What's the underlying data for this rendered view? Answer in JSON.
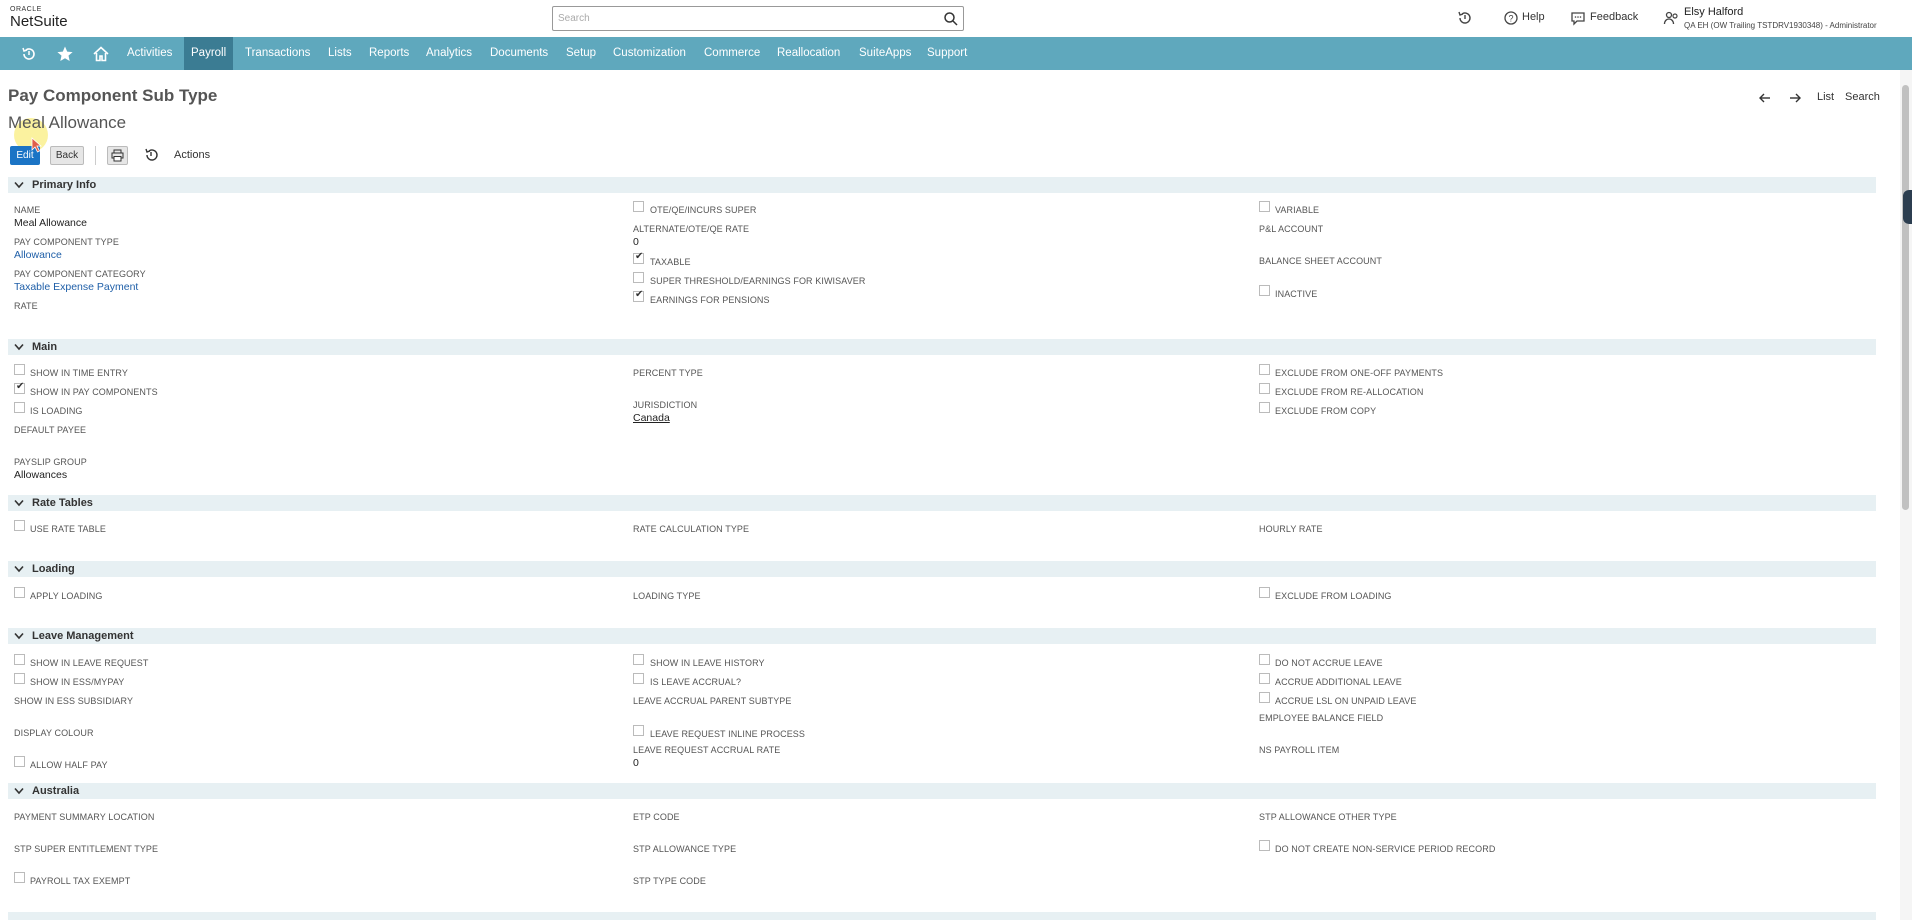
{
  "header": {
    "logo_top": "ORACLE",
    "logo_main": "NetSuite",
    "search_placeholder": "Search",
    "help_label": "Help",
    "feedback_label": "Feedback",
    "user_name": "Elsy Halford",
    "user_role": "QA EH (OW Trailing TSTDRV1930348) - Administrator"
  },
  "nav": {
    "items": [
      "Activities",
      "Payroll",
      "Transactions",
      "Lists",
      "Reports",
      "Analytics",
      "Documents",
      "Setup",
      "Customization",
      "Commerce",
      "Reallocation",
      "SuiteApps",
      "Support"
    ],
    "active": "Payroll"
  },
  "page": {
    "title": "Pay Component Sub Type",
    "record": "Meal Allowance",
    "list_label": "List",
    "search_label": "Search",
    "edit_label": "Edit",
    "back_label": "Back",
    "actions_label": "Actions"
  },
  "sections": {
    "primary": {
      "title": "Primary Info",
      "name_label": "NAME",
      "name_value": "Meal Allowance",
      "type_label": "PAY COMPONENT TYPE",
      "type_value": "Allowance",
      "category_label": "PAY COMPONENT CATEGORY",
      "category_value": "Taxable Expense Payment",
      "rate_label": "RATE",
      "ote_label": "OTE/QE/INCURS SUPER",
      "alt_rate_label": "ALTERNATE/OTE/QE RATE",
      "alt_rate_value": "0",
      "taxable_label": "TAXABLE",
      "super_label": "SUPER THRESHOLD/EARNINGS FOR KIWISAVER",
      "pensions_label": "EARNINGS FOR PENSIONS",
      "variable_label": "VARIABLE",
      "pl_label": "P&L ACCOUNT",
      "bs_label": "BALANCE SHEET ACCOUNT",
      "inactive_label": "INACTIVE"
    },
    "main": {
      "title": "Main",
      "time_entry_label": "SHOW IN TIME ENTRY",
      "pay_comp_label": "SHOW IN PAY COMPONENTS",
      "loading_label": "IS LOADING",
      "default_payee_label": "DEFAULT PAYEE",
      "payslip_group_label": "PAYSLIP GROUP",
      "payslip_group_value": "Allowances",
      "percent_type_label": "PERCENT TYPE",
      "jurisdiction_label": "JURISDICTION",
      "jurisdiction_value": "Canada",
      "excl_oneoff_label": "EXCLUDE FROM ONE-OFF PAYMENTS",
      "excl_realloc_label": "EXCLUDE FROM RE-ALLOCATION",
      "excl_copy_label": "EXCLUDE FROM COPY"
    },
    "rate_tables": {
      "title": "Rate Tables",
      "use_rate_label": "USE RATE TABLE",
      "calc_type_label": "RATE CALCULATION TYPE",
      "hourly_label": "HOURLY RATE"
    },
    "loading": {
      "title": "Loading",
      "apply_label": "APPLY LOADING",
      "type_label": "LOADING TYPE",
      "exclude_label": "EXCLUDE FROM LOADING"
    },
    "leave": {
      "title": "Leave Management",
      "leave_request_label": "SHOW IN LEAVE REQUEST",
      "ess_label": "SHOW IN ESS/MYPAY",
      "ess_sub_label": "SHOW IN ESS SUBSIDIARY",
      "colour_label": "DISPLAY COLOUR",
      "half_pay_label": "ALLOW HALF PAY",
      "history_label": "SHOW IN LEAVE HISTORY",
      "accrual_label": "IS LEAVE ACCRUAL?",
      "parent_label": "LEAVE ACCRUAL PARENT SUBTYPE",
      "inline_label": "LEAVE REQUEST INLINE PROCESS",
      "accrual_rate_label": "LEAVE REQUEST ACCRUAL RATE",
      "accrual_rate_value": "0",
      "no_accrue_label": "DO NOT ACCRUE LEAVE",
      "additional_label": "ACCRUE ADDITIONAL LEAVE",
      "lsl_label": "ACCRUE LSL ON UNPAID LEAVE",
      "balance_label": "EMPLOYEE BALANCE FIELD",
      "ns_item_label": "NS PAYROLL ITEM"
    },
    "australia": {
      "title": "Australia",
      "summary_loc_label": "PAYMENT SUMMARY LOCATION",
      "super_ent_label": "STP SUPER ENTITLEMENT TYPE",
      "tax_exempt_label": "PAYROLL TAX EXEMPT",
      "etp_label": "ETP CODE",
      "stp_allow_label": "STP ALLOWANCE TYPE",
      "stp_code_label": "STP TYPE CODE",
      "other_type_label": "STP ALLOWANCE OTHER TYPE",
      "non_service_label": "DO NOT CREATE NON-SERVICE PERIOD RECORD"
    }
  },
  "colors": {
    "nav_bg": "#5fa8bd",
    "nav_active": "#3b7c93",
    "edit_button": "#1b74c5",
    "section_bg": "#e7f0f3",
    "link": "#1f5fa8"
  }
}
